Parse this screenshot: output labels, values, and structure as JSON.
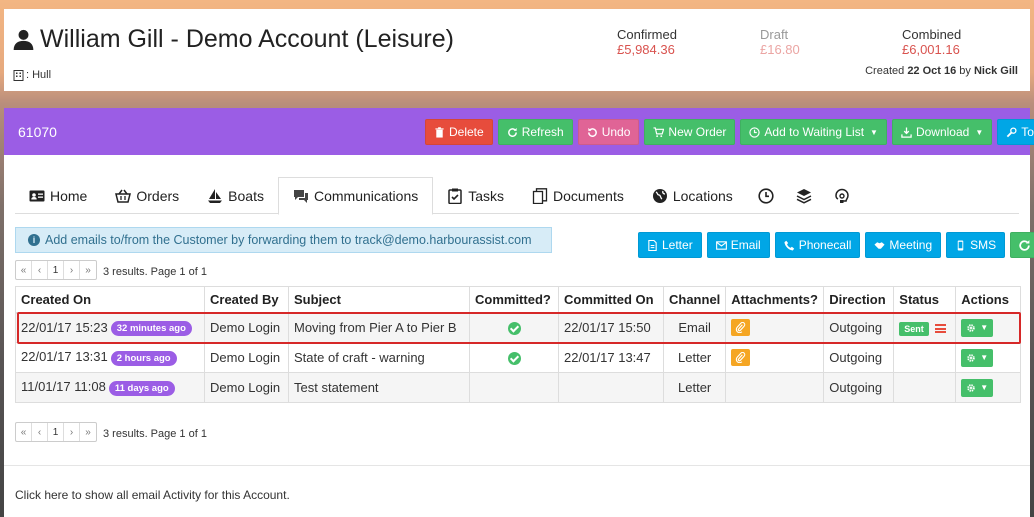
{
  "header": {
    "title": "William Gill - Demo Account (Leisure)",
    "location": ": Hull",
    "stats": [
      {
        "label": "Confirmed",
        "value": "£5,984.36"
      },
      {
        "label": "Draft",
        "value": "£16.80"
      },
      {
        "label": "Combined",
        "value": "£6,001.16"
      }
    ],
    "created_prefix": "Created ",
    "created_date": "22 Oct 16",
    "created_by_word": " by ",
    "created_by": "Nick Gill"
  },
  "toolbar": {
    "record_number": "61070",
    "delete": "Delete",
    "refresh": "Refresh",
    "undo": "Undo",
    "new_order": "New Order",
    "waiting_list": "Add to Waiting List",
    "download": "Download",
    "tools": "Tools"
  },
  "tabs": {
    "home": "Home",
    "orders": "Orders",
    "boats": "Boats",
    "communications": "Communications",
    "tasks": "Tasks",
    "documents": "Documents",
    "locations": "Locations"
  },
  "info_text": "Add emails to/from the Customer by forwarding them to track@demo.harbourassist.com",
  "actions": {
    "letter": "Letter",
    "email": "Email",
    "phonecall": "Phonecall",
    "meeting": "Meeting",
    "sms": "SMS"
  },
  "pager": {
    "first": "«",
    "prev": "‹",
    "page": "1",
    "next": "›",
    "last": "»",
    "summary": "3 results. Page 1 of 1"
  },
  "table": {
    "headers": [
      "Created On",
      "Created By",
      "Subject",
      "Committed?",
      "Committed On",
      "Channel",
      "Attachments?",
      "Direction",
      "Status",
      "Actions"
    ],
    "rows": [
      {
        "created_on": "22/01/17 15:23",
        "age": "32 minutes ago",
        "created_by": "Demo Login",
        "subject": "Moving from Pier A to Pier B",
        "committed_on": "22/01/17 15:50",
        "channel": "Email",
        "direction": "Outgoing",
        "status": "Sent"
      },
      {
        "created_on": "22/01/17 13:31",
        "age": "2 hours ago",
        "created_by": "Demo Login",
        "subject": "State of craft - warning",
        "committed_on": "22/01/17 13:47",
        "channel": "Letter",
        "direction": "Outgoing",
        "status": ""
      },
      {
        "created_on": "11/01/17 11:08",
        "age": "11 days ago",
        "created_by": "Demo Login",
        "subject": "Test statement",
        "committed_on": "",
        "channel": "Letter",
        "direction": "Outgoing",
        "status": ""
      }
    ]
  },
  "footer_text": "Click here to show all email Activity for this Account.",
  "colors": {
    "purple": "#9b5de5",
    "red": "#e74c3c",
    "green": "#45bf6a",
    "pink": "#e06496",
    "blue": "#00a6e6",
    "highlight": "#d62828"
  }
}
